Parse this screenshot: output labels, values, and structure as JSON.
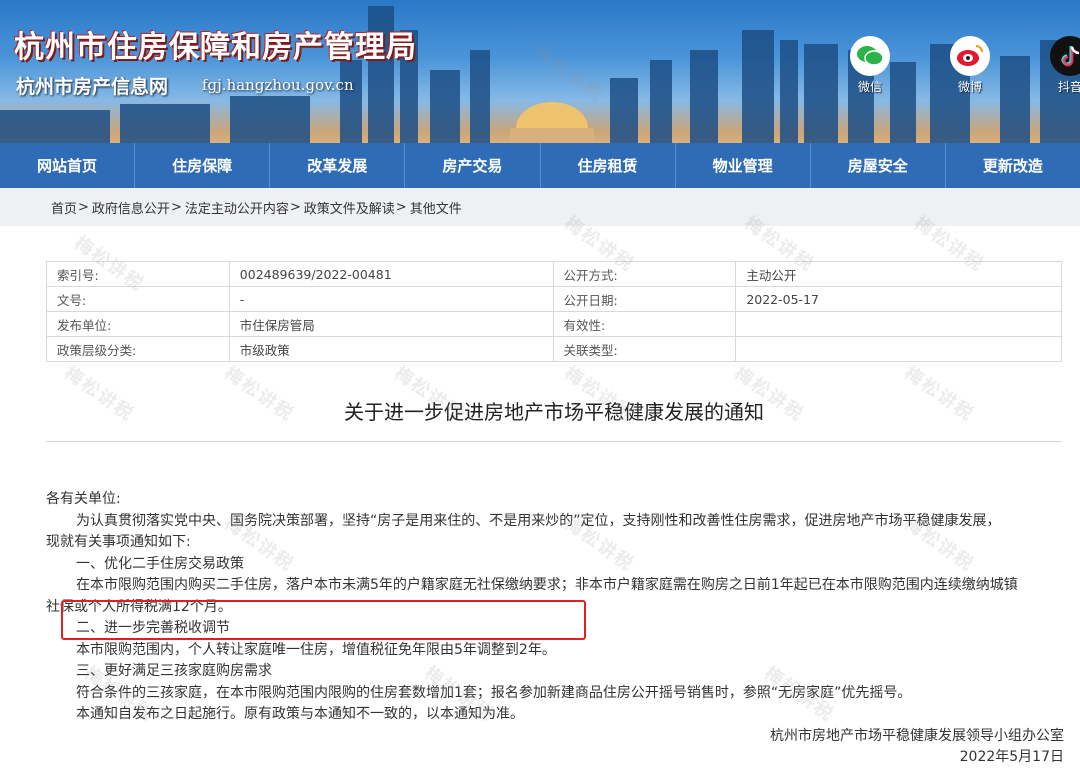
{
  "banner": {
    "title": "杭州市住房保障和房产管理局",
    "subtitle": "杭州市房产信息网",
    "url": "fgj.hangzhou.gov.cn",
    "social": [
      {
        "label": "微信",
        "icon": "wechat-icon"
      },
      {
        "label": "微博",
        "icon": "weibo-icon"
      },
      {
        "label": "抖音",
        "icon": "douyin-icon"
      }
    ]
  },
  "nav": [
    "网站首页",
    "住房保障",
    "改革发展",
    "房产交易",
    "住房租赁",
    "物业管理",
    "房屋安全",
    "更新改造"
  ],
  "breadcrumb": [
    "首页",
    "政府信息公开",
    "法定主动公开内容",
    "政策文件及解读",
    "其他文件"
  ],
  "info": {
    "index_label": "索引号:",
    "index_value": "002489639/2022-00481",
    "open_mode_label": "公开方式:",
    "open_mode_value": "主动公开",
    "doc_no_label": "文号:",
    "doc_no_value": "-",
    "open_date_label": "公开日期:",
    "open_date_value": "2022-05-17",
    "publisher_label": "发布单位:",
    "publisher_value": "市住保房管局",
    "validity_label": "有效性:",
    "validity_value": "",
    "level_label": "政策层级分类:",
    "level_value": "市级政策",
    "relation_label": "关联类型:",
    "relation_value": ""
  },
  "document": {
    "title": "关于进一步促进房地产市场平稳健康发展的通知",
    "greeting": "各有关单位:",
    "intro": "为认真贯彻落实党中央、国务院决策部署，坚持“房子是用来住的、不是用来炒的”定位，支持刚性和改善性住房需求，促进房地产市场平稳健康发展，",
    "intro_cont": "现就有关事项通知如下:",
    "s1_title": "一、优化二手住房交易政策",
    "s1_body": "在本市限购范围内购买二手住房，落户本市未满5年的户籍家庭无社保缴纳要求；非本市户籍家庭需在购房之日前1年起已在本市限购范围内连续缴纳城镇",
    "s1_cont": "社保或个人所得税满12个月。",
    "s2_title": "二、进一步完善税收调节",
    "s2_body": "本市限购范围内，个人转让家庭唯一住房，增值税征免年限由5年调整到2年。",
    "s3_title": "三、更好满足三孩家庭购房需求",
    "s3_body": "符合条件的三孩家庭，在本市限购范围内限购的住房套数增加1套；报名参加新建商品住房公开摇号销售时，参照“无房家庭”优先摇号。",
    "closing": "本通知自发布之日起施行。原有政策与本通知不一致的，以本通知为准。",
    "signature": "杭州市房地产市场平稳健康发展领导小组办公室",
    "date": "2022年5月17日"
  },
  "watermark": "梅松讲税",
  "colors": {
    "nav_bg": "#2f6cb5",
    "highlight": "#e02020",
    "crumb_bg": "#eef0f3"
  }
}
